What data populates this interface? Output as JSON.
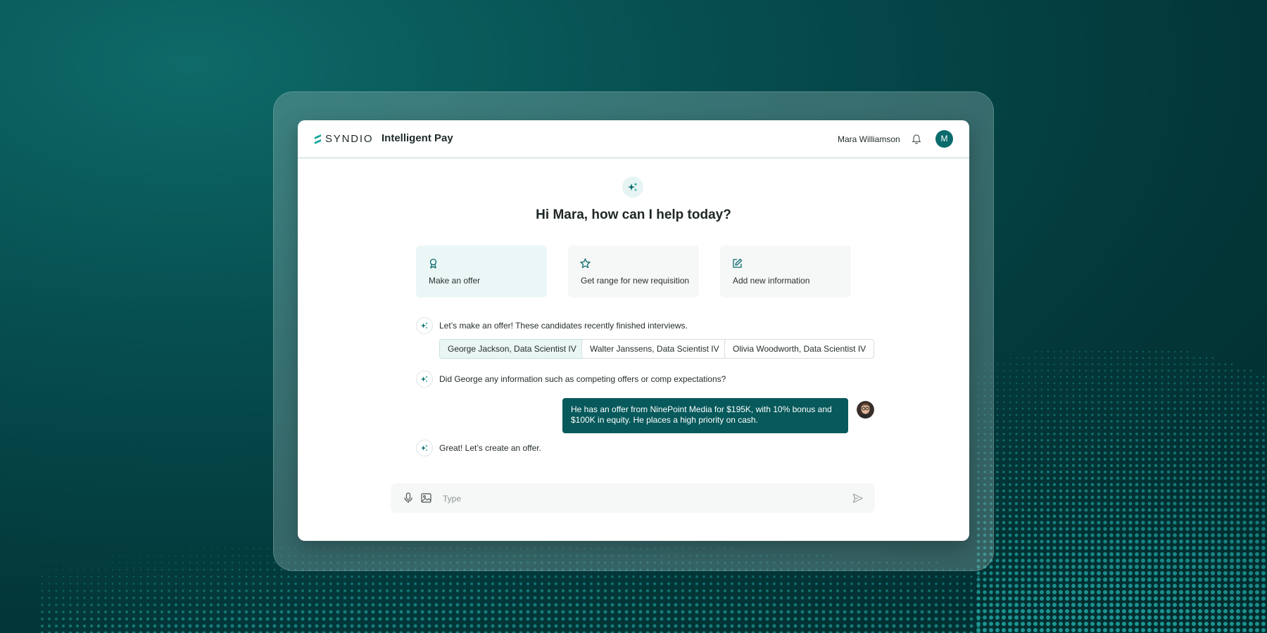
{
  "brand": {
    "logo_text": "SYNDIO",
    "app_title": "Intelligent Pay"
  },
  "header": {
    "user_name": "Mara Williamson",
    "avatar_initial": "M"
  },
  "greeting": "Hi Mara, how can I help today?",
  "quick_actions": [
    {
      "label": "Make an offer",
      "icon": "award-icon",
      "active": true
    },
    {
      "label": "Get range for new requisition",
      "icon": "star-icon",
      "active": false
    },
    {
      "label": "Add new information",
      "icon": "edit-icon",
      "active": false
    }
  ],
  "conversation": {
    "assistant_intro": "Let’s make an offer! These candidates recently finished interviews.",
    "candidates": [
      "George Jackson, Data Scientist IV",
      "Walter Janssens, Data Scientist IV",
      "Olivia Woodworth, Data Scientist IV"
    ],
    "assistant_question": "Did George any information such as competing offers or comp expectations?",
    "user_reply": "He has an offer from NinePoint Media for $195K, with 10% bonus and $100K in equity. He places a high priority on cash.",
    "assistant_followup": "Great! Let’s create an offer."
  },
  "composer": {
    "placeholder": "Type"
  },
  "colors": {
    "primary": "#07595b",
    "accent": "#1aa39a",
    "background": "#033638"
  }
}
